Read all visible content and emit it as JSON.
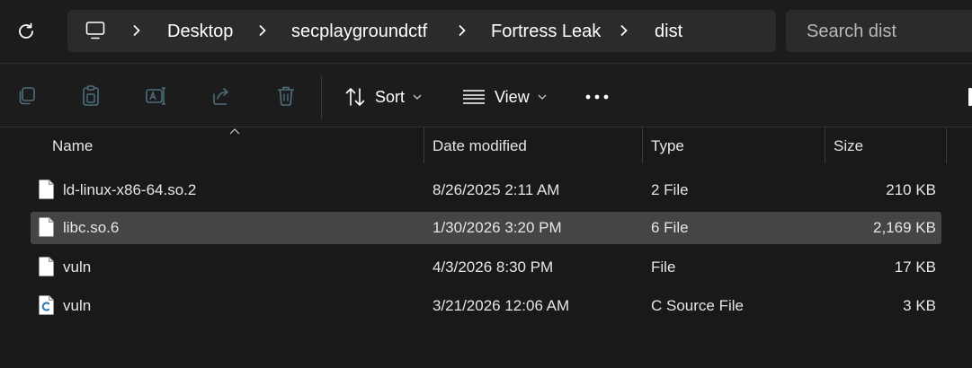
{
  "address_bar": {
    "breadcrumbs": [
      "Desktop",
      "secplaygroundctf",
      "Fortress Leak",
      "dist"
    ]
  },
  "search": {
    "placeholder": "Search dist"
  },
  "toolbar": {
    "sort_label": "Sort",
    "view_label": "View"
  },
  "columns": [
    "Name",
    "Date modified",
    "Type",
    "Size"
  ],
  "files": [
    {
      "name": "ld-linux-x86-64.so.2",
      "date": "8/26/2025 2:11 AM",
      "type": "2 File",
      "size": "210 KB",
      "icon": "file-icon",
      "selected": false
    },
    {
      "name": "libc.so.6",
      "date": "1/30/2026 3:20 PM",
      "type": "6 File",
      "size": "2,169 KB",
      "icon": "file-icon",
      "selected": true
    },
    {
      "name": "vuln",
      "date": "4/3/2026 8:30 PM",
      "type": "File",
      "size": "17 KB",
      "icon": "file-icon",
      "selected": false
    },
    {
      "name": "vuln",
      "date": "3/21/2026 12:06 AM",
      "type": "C Source File",
      "size": "3 KB",
      "icon": "c-source-file-icon",
      "selected": false
    }
  ],
  "colors": {
    "background": "#191919",
    "address_bg": "#2b2b2b",
    "selected_row": "#454545",
    "text": "#e6e6e6",
    "muted_icon": "#5f8a9a"
  }
}
